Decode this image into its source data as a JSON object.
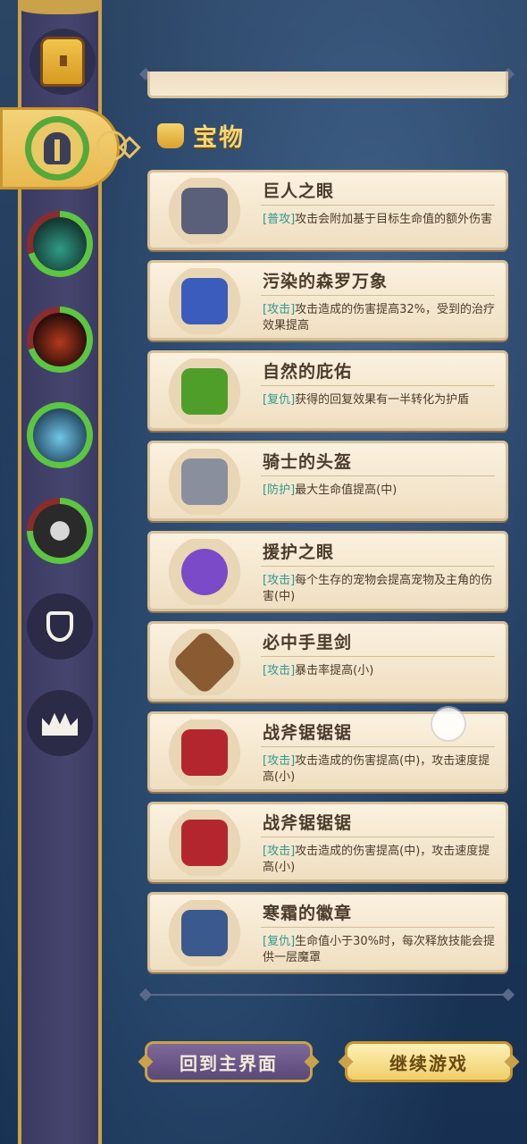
{
  "section": {
    "title": "宝物"
  },
  "items": [
    {
      "name": "巨人之眼",
      "tag": "[普攻]",
      "desc": "攻击会附加基于目标生命值的额外伤害",
      "color": "#5a5f7a"
    },
    {
      "name": "污染的森罗万象",
      "tag": "[攻击]",
      "desc": "攻击造成的伤害提高32%，受到的治疗效果提高",
      "color": "#3b5bbd"
    },
    {
      "name": "自然的庇佑",
      "tag": "[复仇]",
      "desc": "获得的回复效果有一半转化为护盾",
      "color": "#4f9e2a"
    },
    {
      "name": "骑士的头盔",
      "tag": "[防护]",
      "desc": "最大生命值提高(中)",
      "color": "#8a8f9e"
    },
    {
      "name": "援护之眼",
      "tag": "[攻击]",
      "desc": "每个生存的宠物会提高宠物及主角的伤害(中)",
      "color": "#7a4ac8"
    },
    {
      "name": "必中手里剑",
      "tag": "[攻击]",
      "desc": "暴击率提高(小)",
      "color": "#8a5a32"
    },
    {
      "name": "战斧锯锯锯",
      "tag": "[攻击]",
      "desc": "攻击造成的伤害提高(中)，攻击速度提高(小)",
      "color": "#b3262e"
    },
    {
      "name": "战斧锯锯锯",
      "tag": "[攻击]",
      "desc": "攻击造成的伤害提高(中)，攻击速度提高(小)",
      "color": "#b3262e"
    },
    {
      "name": "寒霜的徽章",
      "tag": "[复仇]",
      "desc": "生命值小于30%时，每次释放技能会提供一层魔罩",
      "color": "#3a5a8e"
    }
  ],
  "buttons": {
    "home": "回到主界面",
    "continue": "继续游戏"
  },
  "sidebar": {
    "icons": [
      "chest-icon",
      "helmet-icon",
      "pet-hydra",
      "pet-fire-demon",
      "pet-ice-knight",
      "pet-wolf",
      "potion-icon",
      "crown-icon"
    ]
  },
  "colors": {
    "accent": "#f7d774",
    "tag": "#2f9a8c",
    "active_ring": "#55a83a"
  }
}
